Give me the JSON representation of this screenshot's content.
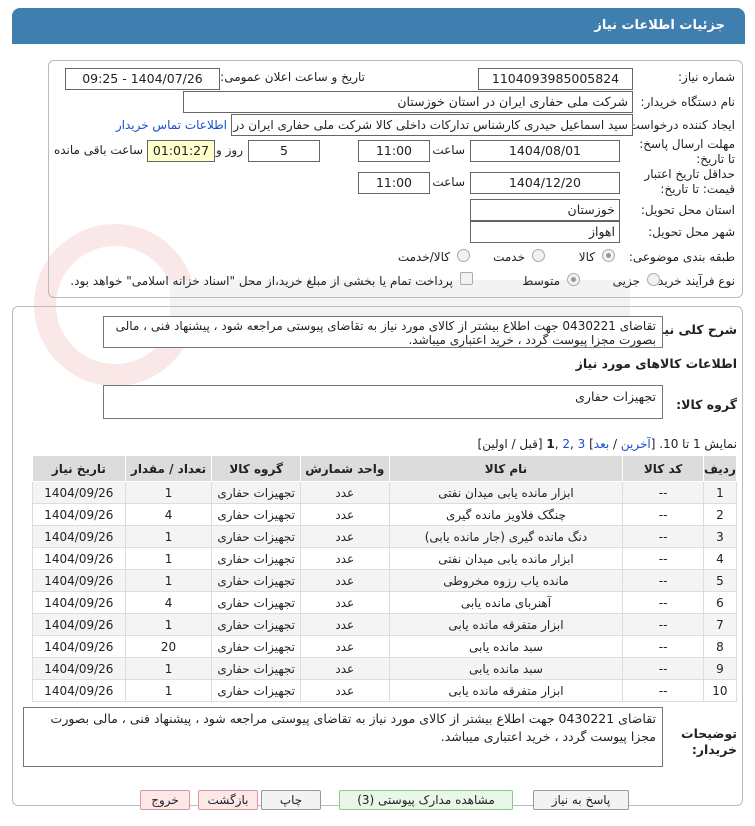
{
  "title": "جزئیات اطلاعات نیاز",
  "fields": {
    "need_number_label": "شماره نیاز:",
    "need_number": "1104093985005824",
    "announce_label": "تاریخ و ساعت اعلان عمومی:",
    "announce_value": "1404/07/26 - 09:25",
    "buyer_label": "نام دستگاه خریدار:",
    "buyer": "شرکت ملی حفاری ایران در استان خوزستان",
    "creator_label": "ایجاد کننده درخواست:",
    "creator": "سید اسماعیل حیدری کارشناس تدارکات داخلی کالا شرکت ملی حفاری ایران در",
    "contact_link": "اطلاعات تماس خریدار",
    "deadline_label": "مهلت ارسال پاسخ: تا تاریخ:",
    "deadline_date": "1404/08/01",
    "time_label": "ساعت",
    "deadline_time": "11:00",
    "days_value": "5",
    "days_label": "روز و",
    "remaining_time": "01:01:27",
    "remaining_label": "ساعت باقی مانده",
    "validity_label": "حداقل تاریخ اعتبار قیمت: تا تاریخ:",
    "validity_date": "1404/12/20",
    "validity_time": "11:00",
    "province_label": "استان محل تحویل:",
    "province": "خوزستان",
    "city_label": "شهر محل تحویل:",
    "city": "اهواز",
    "category_label": "طبقه بندی موضوعی:",
    "cat_goods": "کالا",
    "cat_service": "خدمت",
    "cat_goods_service": "کالا/خدمت",
    "process_label": "نوع فرآیند خرید :",
    "proc_partial": "جزیی",
    "proc_medium": "متوسط",
    "treasury_note": "پرداخت تمام یا بخشی از مبلغ خرید،از محل \"اسناد خزانه اسلامی\" خواهد بود."
  },
  "description": {
    "label": "شرح کلی نیاز:",
    "text": "تقاضای 0430221 جهت اطلاع بیشتر از کالای مورد نیاز به تقاضای پیوستی مراجعه شود ، پیشنهاد فنی ، مالی بصورت مجزا پیوست گردد ، خرید اعتباری میباشد."
  },
  "goods_info_label": "اطلاعات کالاهای مورد نیاز",
  "goods_group": {
    "label": "گروه کالا:",
    "value": "تجهیزات حفاری"
  },
  "pager": {
    "prefix": "نمایش 1 تا 10. [",
    "last": "آخرین",
    "sep1": " / ",
    "next": "بعد",
    "sep2": "] ",
    "p3": "3",
    "comma1": " ,",
    "p2": "2",
    "comma2": " ,",
    "p1": "1",
    "suffix": " [قبل / اولین]"
  },
  "table": {
    "headers": [
      "ردیف",
      "کد کالا",
      "نام کالا",
      "واحد شمارش",
      "گروه کالا",
      "تعداد / مقدار",
      "تاریخ نیاز"
    ],
    "rows": [
      [
        "1",
        "--",
        "ابزار مانده یابی میدان نفتی",
        "عدد",
        "تجهیزات حفاری",
        "1",
        "1404/09/26"
      ],
      [
        "2",
        "--",
        "چنگک فلاویز مانده گیری",
        "عدد",
        "تجهیزات حفاری",
        "4",
        "1404/09/26"
      ],
      [
        "3",
        "--",
        "دنگ مانده گیری (جار مانده یابی)",
        "عدد",
        "تجهیزات حفاری",
        "1",
        "1404/09/26"
      ],
      [
        "4",
        "--",
        "ابزار مانده یابی میدان نفتی",
        "عدد",
        "تجهیزات حفاری",
        "1",
        "1404/09/26"
      ],
      [
        "5",
        "--",
        "مانده یاب رزوه مخروطی",
        "عدد",
        "تجهیزات حفاری",
        "1",
        "1404/09/26"
      ],
      [
        "6",
        "--",
        "آهنربای مانده یابی",
        "عدد",
        "تجهیزات حفاری",
        "4",
        "1404/09/26"
      ],
      [
        "7",
        "--",
        "ابزار متفرقه مانده یابی",
        "عدد",
        "تجهیزات حفاری",
        "1",
        "1404/09/26"
      ],
      [
        "8",
        "--",
        "سبد مانده یابی",
        "عدد",
        "تجهیزات حفاری",
        "20",
        "1404/09/26"
      ],
      [
        "9",
        "--",
        "سبد مانده یابی",
        "عدد",
        "تجهیزات حفاری",
        "1",
        "1404/09/26"
      ],
      [
        "10",
        "--",
        "ابزار متفرقه مانده یابی",
        "عدد",
        "تجهیزات حفاری",
        "1",
        "1404/09/26"
      ]
    ]
  },
  "buyer_notes": {
    "label": "توضیحات خریدار:",
    "text": "تقاضای 0430221 جهت اطلاع بیشتر از کالای مورد نیاز به تقاضای پیوستی مراجعه شود ، پیشنهاد فنی ، مالی بصورت مجزا پیوست گردد ، خرید اعتباری میباشد."
  },
  "buttons": {
    "reply": "پاسخ به نیاز",
    "attachments": "مشاهده مدارک پیوستی (3)",
    "print": "چاپ",
    "back": "بازگشت",
    "exit": "خروج"
  },
  "colors": {
    "title_bg": "#3f7faf",
    "link": "#1a4fcf",
    "remaining_bg": "#ffffcc"
  }
}
